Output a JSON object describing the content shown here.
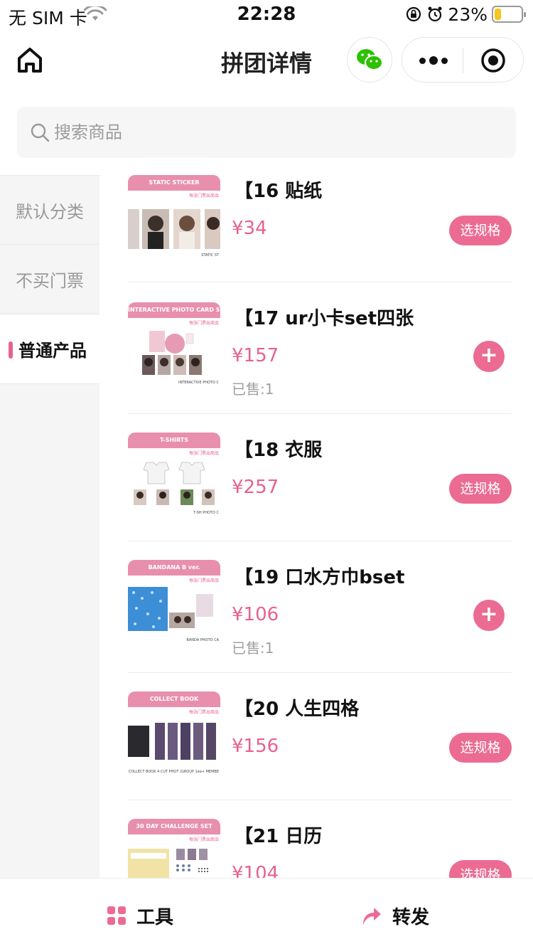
{
  "status_bar": {
    "carrier": "无 SIM 卡",
    "time": "22:28",
    "battery_pct": "23%"
  },
  "nav": {
    "title": "拼团详情"
  },
  "search": {
    "placeholder": "搜索商品"
  },
  "sidebar": {
    "items": [
      {
        "label": "默认分类",
        "active": false
      },
      {
        "label": "不买门票",
        "active": false
      },
      {
        "label": "普通产品",
        "active": true
      }
    ]
  },
  "products": [
    {
      "name": "【16 贴纸",
      "price": "¥34",
      "sold": "",
      "action": "选规格",
      "thumb_banner": "STATIC STICKER",
      "thumb_sub": "每张门票出商品",
      "thumb_foot": "STATIC ST"
    },
    {
      "name": "【17 ur小卡set四张",
      "price": "¥157",
      "sold": "已售:1",
      "action": "+",
      "thumb_banner": "INTERACTIVE PHOTO CARD SET",
      "thumb_sub": "每张门票出商品",
      "thumb_foot": "INTERACTIVE PHOTO C"
    },
    {
      "name": "【18 衣服",
      "price": "¥257",
      "sold": "",
      "action": "选规格",
      "thumb_banner": "T-SHIRTS",
      "thumb_sub": "每张门票出商品",
      "thumb_foot": "T-SH PHOTO C"
    },
    {
      "name": "【19 口水方巾bset",
      "price": "¥106",
      "sold": "已售:1",
      "action": "+",
      "thumb_banner": "BANDANA B ver.",
      "thumb_sub": "每张门票出商品",
      "thumb_foot": "BANDA PHOTO CA"
    },
    {
      "name": "【20 人生四格",
      "price": "¥156",
      "sold": "",
      "action": "选规格",
      "thumb_banner": "COLLECT BOOK",
      "thumb_sub": "每张门票出商品",
      "thumb_foot": "COLLECT BOOK 4 CUT PHOT (GROUP 1ea+ MEMBE"
    },
    {
      "name": "【21 日历",
      "price": "¥104",
      "sold": "",
      "action": "选规格",
      "thumb_banner": "30 DAY CHALLENGE SET",
      "thumb_sub": "每张门票出商品",
      "thumb_foot": ""
    }
  ],
  "bottom_bar": {
    "tool_label": "工具",
    "share_label": "转发"
  },
  "colors": {
    "accent": "#eb6b93",
    "price": "#e8618c",
    "sidebar_bg": "#f5f5f5"
  },
  "icons": [
    "wifi-icon",
    "lock-rotation-icon",
    "alarm-icon",
    "home-icon",
    "wechat-icon",
    "more-icon",
    "close-miniprogram-icon",
    "search-icon",
    "grid-icon",
    "share-arrow-icon"
  ]
}
